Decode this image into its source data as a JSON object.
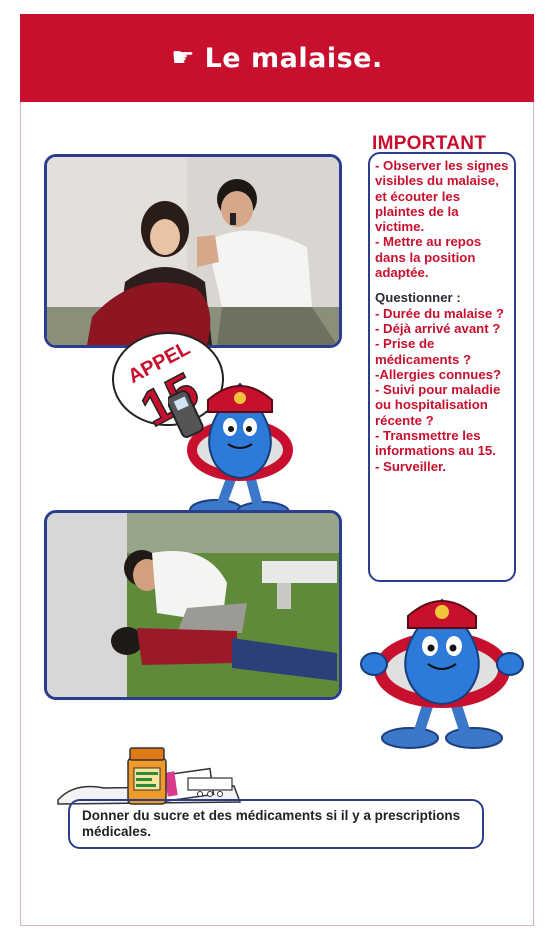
{
  "header": {
    "title": "Le malaise."
  },
  "badge": {
    "line1": "APPEL",
    "line2": "15"
  },
  "important": {
    "title": "IMPORTANT",
    "paragraphs": [
      "- Observer les signes visibles du malaise, et écouter les plaintes de la victime.",
      "- Mettre au repos dans la position adaptée."
    ],
    "questions_title": "Questionner :",
    "questions": [
      "- Durée du malaise ?",
      "- Déjà arrivé avant ?",
      "- Prise de médicaments ?",
      "-Allergies connues?",
      "- Suivi pour maladie ou hospitalisation récente ?",
      "- Transmettre les informations au 15.",
      "- Surveiller."
    ]
  },
  "note": {
    "text": "Donner du sucre et des médicaments si il y a prescriptions médicales."
  },
  "colors": {
    "banner_red": "#c8102e",
    "frame_blue": "#2b3d8f",
    "text_red": "#c8102e"
  },
  "icons": {
    "banner_pointer": "hand-pointing-right-icon",
    "mascot": "firefighter-drop-mascot-icon",
    "meds": "medicine-bottle-icon"
  }
}
